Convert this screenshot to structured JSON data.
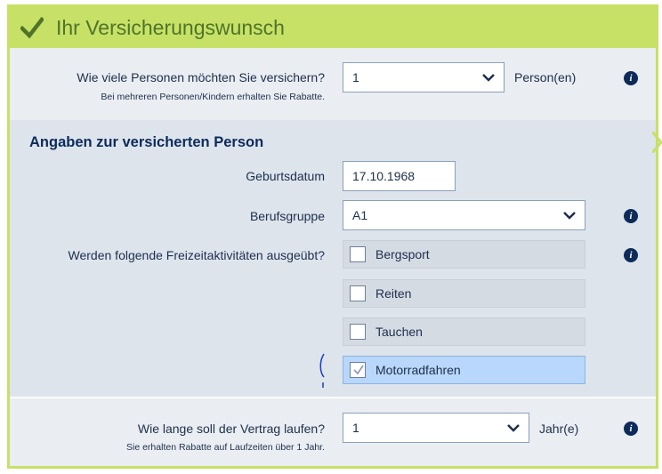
{
  "header": {
    "title": "Ihr Versicherungswunsch",
    "icon": "checkmark-icon"
  },
  "persons": {
    "label": "Wie viele Personen möchten Sie versichern?",
    "hint": "Bei mehreren Personen/Kindern erhalten Sie Rabatte.",
    "value": "1",
    "unit": "Person(en)"
  },
  "insured": {
    "heading": "Angaben zur versicherten Person",
    "birthdate_label": "Geburtsdatum",
    "birthdate_value": "17.10.1968",
    "job_label": "Berufsgruppe",
    "job_value": "A1",
    "activities_label": "Werden folgende Freizeitaktivitäten ausgeübt?",
    "activities": [
      {
        "label": "Bergsport",
        "checked": false
      },
      {
        "label": "Reiten",
        "checked": false
      },
      {
        "label": "Tauchen",
        "checked": false
      },
      {
        "label": "Motorradfahren",
        "checked": true
      }
    ]
  },
  "contract": {
    "label": "Wie lange soll der Vertrag laufen?",
    "hint": "Sie erhalten Rabatte auf Laufzeiten über 1 Jahr.",
    "value": "1",
    "unit": "Jahr(e)"
  },
  "info_glyph": "i",
  "colors": {
    "header": "#c6e166",
    "title": "#4f7429",
    "navy": "#0d2b5a",
    "checked_row": "#b9d7fb"
  }
}
